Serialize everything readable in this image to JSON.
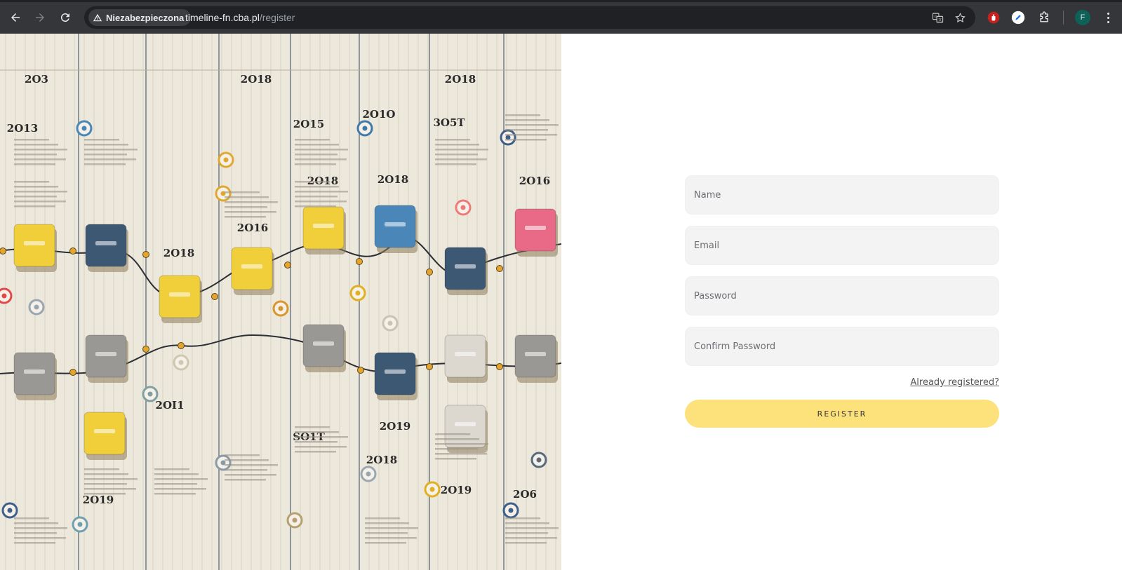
{
  "browser": {
    "security_label": "Niezabezpieczona",
    "url_host": "timeline-fn.cba.pl",
    "url_path": "/register",
    "profile_initial": "F",
    "colors": {
      "frame": "#35363a",
      "omnibox": "#202124",
      "profile": "#0d6157"
    }
  },
  "hero": {
    "timeline_years": [
      "2O3",
      "2O18",
      "2O18",
      "2O13",
      "2O1O",
      "3O5T",
      "2O15",
      "2O18",
      "2O18",
      "2O16",
      "2O16",
      "2O18",
      "2O19",
      "2OI1",
      "2O19",
      "SO1T",
      "2O19",
      "2O18",
      "2O6"
    ],
    "card_colors": [
      "#f0cf3a",
      "#3d5873",
      "#9a9895",
      "#4a86b8",
      "#e86a87",
      "#dcd8cf"
    ]
  },
  "form": {
    "name_placeholder": "Name",
    "email_placeholder": "Email",
    "password_placeholder": "Password",
    "confirm_placeholder": "Confirm Password",
    "already_link": "Already registered?",
    "register_label": "REGISTER",
    "accent_color": "#fde17a"
  }
}
